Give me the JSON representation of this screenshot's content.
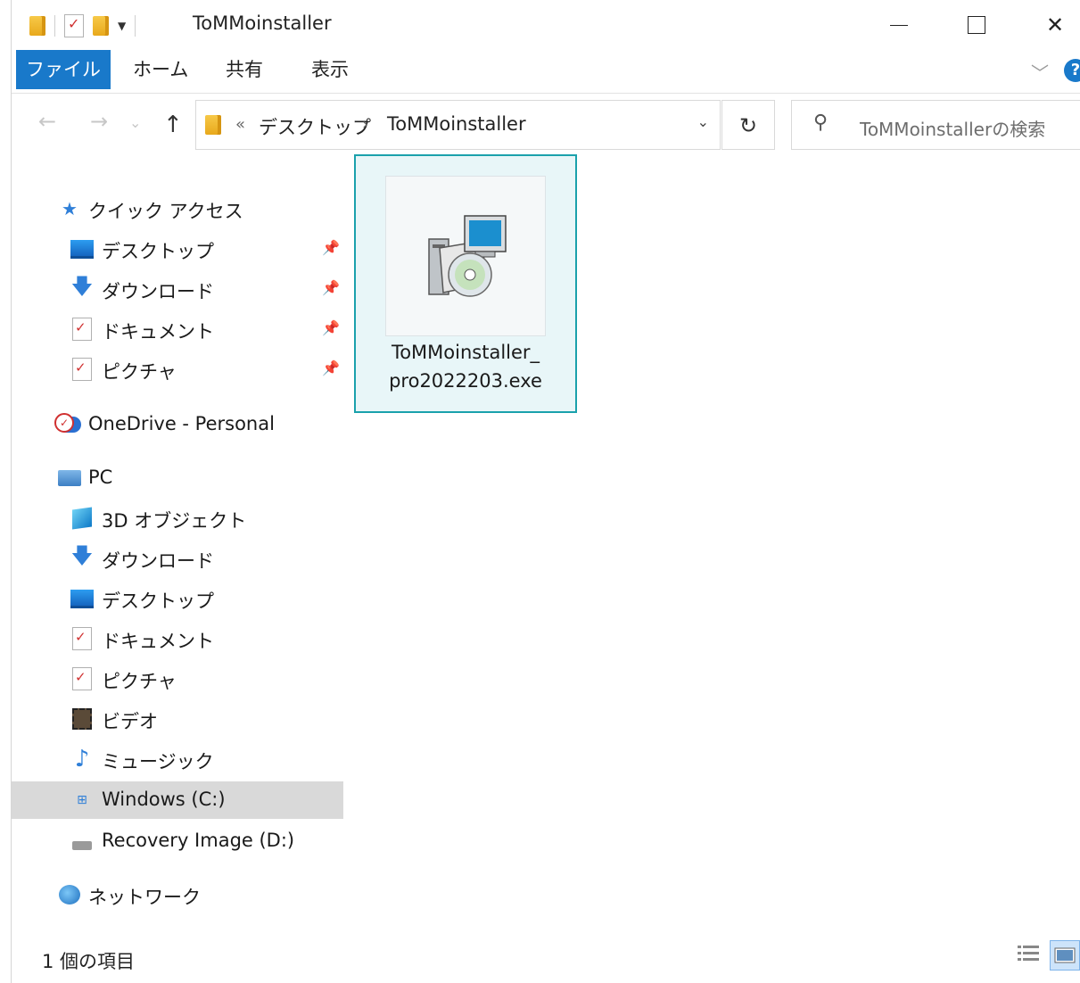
{
  "window": {
    "title": "ToMMoinstaller"
  },
  "ribbon": {
    "tabs": [
      {
        "label": "ファイル",
        "active": true
      },
      {
        "label": "ホーム"
      },
      {
        "label": "共有"
      },
      {
        "label": "表示"
      }
    ],
    "help_label": "?"
  },
  "address": {
    "overflow_marker": "«",
    "crumbs": [
      "デスクトップ",
      "ToMMoinstaller"
    ],
    "separator": "›"
  },
  "search": {
    "placeholder": "ToMMoinstallerの検索"
  },
  "sidebar": {
    "quick_access": {
      "label": "クイック アクセス",
      "items": [
        {
          "label": "デスクトップ",
          "icon": "desktop-icon",
          "pinned": true
        },
        {
          "label": "ダウンロード",
          "icon": "download-icon",
          "pinned": true
        },
        {
          "label": "ドキュメント",
          "icon": "documents-icon",
          "pinned": true
        },
        {
          "label": "ピクチャ",
          "icon": "pictures-icon",
          "pinned": true
        }
      ]
    },
    "onedrive": {
      "label": "OneDrive - Personal",
      "icon": "onedrive-icon"
    },
    "pc": {
      "label": "PC",
      "items": [
        {
          "label": "3D オブジェクト",
          "icon": "3d-objects-icon"
        },
        {
          "label": "ダウンロード",
          "icon": "download-icon"
        },
        {
          "label": "デスクトップ",
          "icon": "desktop-icon"
        },
        {
          "label": "ドキュメント",
          "icon": "documents-icon"
        },
        {
          "label": "ピクチャ",
          "icon": "pictures-icon"
        },
        {
          "label": "ビデオ",
          "icon": "videos-icon"
        },
        {
          "label": "ミュージック",
          "icon": "music-icon"
        },
        {
          "label": "Windows (C:)",
          "icon": "windows-drive-icon",
          "selected": true
        },
        {
          "label": "Recovery Image (D:)",
          "icon": "drive-icon"
        }
      ]
    },
    "network": {
      "label": "ネットワーク",
      "icon": "network-icon"
    }
  },
  "files": [
    {
      "name_line1": "ToMMoinstaller_",
      "name_line2": "pro2022203.exe",
      "icon": "installer-icon",
      "selected": true
    }
  ],
  "status": {
    "item_count": "1 個の項目"
  },
  "colors": {
    "accent": "#1979ca",
    "selection_border": "#1aa1ac",
    "selection_fill": "#e8f6f8"
  }
}
